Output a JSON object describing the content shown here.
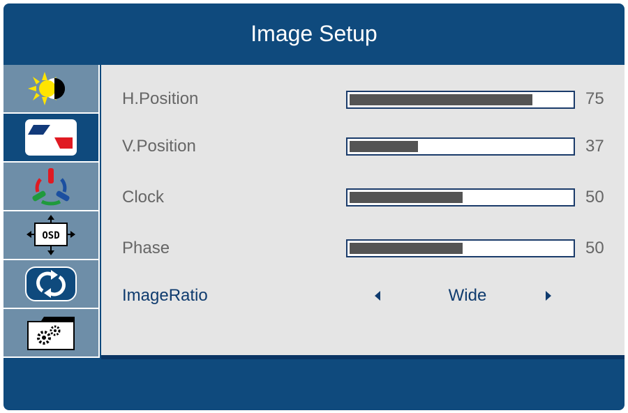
{
  "title": "Image Setup",
  "sidebar": {
    "items": [
      {
        "icon": "brightness-contrast-icon",
        "active": false
      },
      {
        "icon": "image-setup-icon",
        "active": true
      },
      {
        "icon": "color-setup-icon",
        "active": false
      },
      {
        "icon": "osd-setup-icon",
        "active": false
      },
      {
        "icon": "reset-icon",
        "active": false
      },
      {
        "icon": "misc-settings-icon",
        "active": false
      }
    ]
  },
  "settings": [
    {
      "label": "H.Position",
      "value": "75",
      "level": 75
    },
    {
      "label": "V.Position",
      "value": "37",
      "level": 37
    },
    {
      "label": "Clock",
      "value": "50",
      "level": 50
    },
    {
      "label": "Phase",
      "value": "50",
      "level": 50
    }
  ],
  "image_ratio": {
    "label": "ImageRatio",
    "value": "Wide"
  },
  "colors": {
    "frame": "#0f4a7d",
    "sidebar_item": "#6e8ea8",
    "content_bg": "#e5e5e5",
    "bar_fill": "#545454",
    "selected_text": "#0f3b6e"
  }
}
